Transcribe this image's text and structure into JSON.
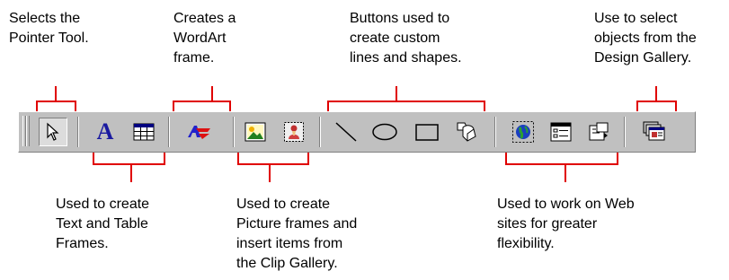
{
  "callouts": {
    "pointer": [
      "Selects the",
      "Pointer Tool."
    ],
    "wordart": [
      "Creates a",
      "WordArt",
      "frame."
    ],
    "shapes": [
      "Buttons used to",
      "create custom",
      "lines and shapes."
    ],
    "design_gallery": [
      "Use to select",
      "objects from the",
      "Design Gallery."
    ],
    "text_table": [
      "Used to create",
      "Text and Table",
      "Frames."
    ],
    "picture": [
      "Used to create",
      "Picture frames and",
      "insert items from",
      "the Clip Gallery."
    ],
    "web": [
      "Used to work on Web",
      "sites for greater",
      "flexibility."
    ]
  },
  "toolbar": {
    "buttons": [
      {
        "name": "pointer-tool",
        "icon": "arrow-pointer-icon"
      },
      {
        "name": "text-frame-tool",
        "icon": "letter-a-icon",
        "glyph": "A"
      },
      {
        "name": "table-frame-tool",
        "icon": "table-grid-icon"
      },
      {
        "name": "wordart-frame-tool",
        "icon": "wordart-icon"
      },
      {
        "name": "picture-frame-tool",
        "icon": "picture-icon"
      },
      {
        "name": "clip-gallery-tool",
        "icon": "clip-gallery-icon"
      },
      {
        "name": "line-tool",
        "icon": "line-icon"
      },
      {
        "name": "oval-tool",
        "icon": "oval-icon"
      },
      {
        "name": "rectangle-tool",
        "icon": "rectangle-icon"
      },
      {
        "name": "custom-shapes-tool",
        "icon": "custom-shapes-icon"
      },
      {
        "name": "hot-spot-tool",
        "icon": "globe-icon"
      },
      {
        "name": "form-control-tool",
        "icon": "form-control-icon"
      },
      {
        "name": "html-code-fragment-tool",
        "icon": "html-fragment-icon"
      },
      {
        "name": "design-gallery-object-tool",
        "icon": "design-gallery-icon"
      }
    ]
  },
  "colors": {
    "bracket": "#e00000",
    "toolbar_face": "#c0c0c0",
    "text_a": "#1a1aa0",
    "wordart_blue": "#2222cc",
    "wordart_red": "#dd1111"
  }
}
